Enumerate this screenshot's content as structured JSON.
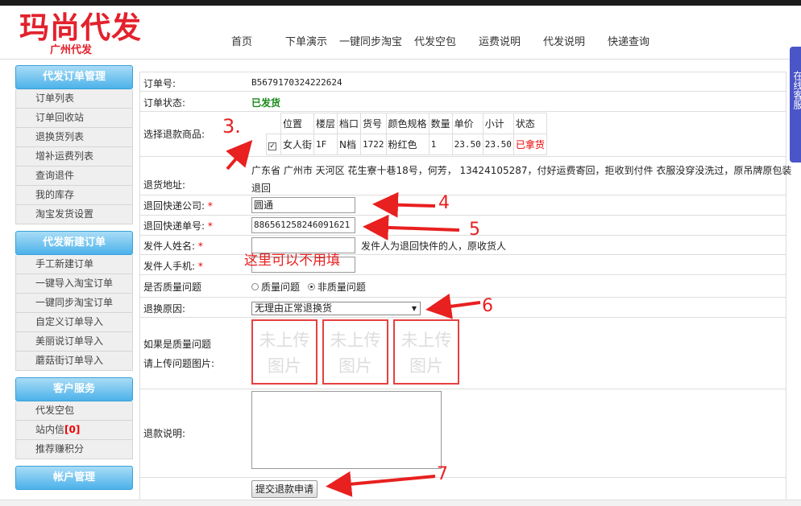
{
  "logo": {
    "title": "玛尚代发",
    "subtitle": "广州代发"
  },
  "nav": [
    "首页",
    "下单演示",
    "一键同步淘宝",
    "代发空包",
    "运费说明",
    "代发说明",
    "快递查询"
  ],
  "side_tab": "在线客服",
  "sidebar": {
    "groups": [
      {
        "title": "代发订单管理",
        "items": [
          "订单列表",
          "订单回收站",
          "退换货列表",
          "增补运费列表",
          "查询退件",
          "我的库存",
          "淘宝发货设置"
        ]
      },
      {
        "title": "代发新建订单",
        "items": [
          "手工新建订单",
          "一键导入淘宝订单",
          "一键同步淘宝订单",
          "自定义订单导入",
          "美丽说订单导入",
          "蘑菇街订单导入"
        ]
      },
      {
        "title": "客户服务",
        "items": [
          "代发空包",
          "站内信",
          "推荐赚积分"
        ],
        "msg_count": "[0]"
      },
      {
        "title": "帐户管理",
        "items": []
      }
    ]
  },
  "form": {
    "order_no_label": "订单号:",
    "order_no": "B5679170324222624",
    "status_label": "订单状态:",
    "status": "已发货",
    "goods_label": "选择退款商品:",
    "goods_headers": [
      "位置",
      "楼层",
      "档口",
      "货号",
      "颜色规格",
      "数量",
      "单价",
      "小计",
      "状态"
    ],
    "goods_row": [
      "女人街",
      "1F",
      "N档",
      "1722",
      "粉红色",
      "1",
      "23.50",
      "23.50",
      "已拿货"
    ],
    "addr_label": "退货地址:",
    "addr_line1": "广东省 广州市 天河区 花生寮十巷18号，何芳， 13424105287，付好运费寄回，拒收到付件 衣服没穿没洗过，原吊牌原包装",
    "addr_line2": "退回",
    "company_label": "退回快递公司:",
    "company": "圆通",
    "tracking_label": "退回快递单号:",
    "tracking": "886561258246091621",
    "sender_name_label": "发件人姓名:",
    "sender_hint": "发件人为退回快件的人，原收货人",
    "sender_phone_label": "发件人手机:",
    "quality_label": "是否质量问题",
    "quality_opt1": "质量问题",
    "quality_opt2": "非质量问题",
    "reason_label": "退换原因:",
    "reason": "无理由正常退换货",
    "images_label1": "如果是质量问题",
    "images_label2": "请上传问题图片:",
    "upload_text1": "未上传",
    "upload_text2": "图片",
    "note_label": "退款说明:",
    "submit": "提交退款申请"
  },
  "annotations": {
    "a3": "3.",
    "a4": "4",
    "a5": "5",
    "a6": "6",
    "a7": "7",
    "hint": "这里可以不用填"
  },
  "colors": {
    "accent": "#4cb2ea",
    "annotation": "#e82020",
    "logo": "#e3212c"
  }
}
